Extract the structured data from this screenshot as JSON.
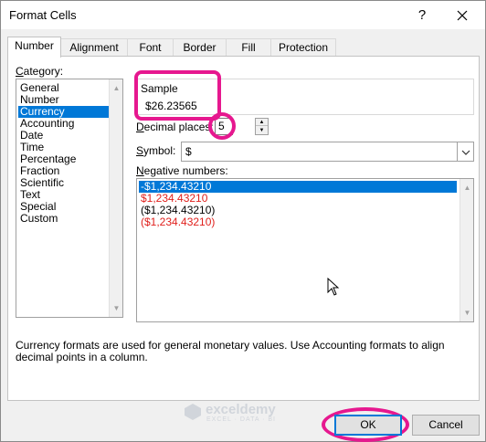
{
  "window": {
    "title": "Format Cells",
    "help_label": "?"
  },
  "tabs": [
    {
      "label": "Number",
      "active": true
    },
    {
      "label": "Alignment",
      "active": false
    },
    {
      "label": "Font",
      "active": false
    },
    {
      "label": "Border",
      "active": false
    },
    {
      "label": "Fill",
      "active": false
    },
    {
      "label": "Protection",
      "active": false
    }
  ],
  "category": {
    "label": "Category:",
    "items": [
      "General",
      "Number",
      "Currency",
      "Accounting",
      "Date",
      "Time",
      "Percentage",
      "Fraction",
      "Scientific",
      "Text",
      "Special",
      "Custom"
    ],
    "selected": "Currency"
  },
  "sample": {
    "label": "Sample",
    "value": "$26.23565"
  },
  "decimal_places": {
    "label": "Decimal places:",
    "value": "5"
  },
  "symbol": {
    "label": "Symbol:",
    "value": "$"
  },
  "negative_numbers": {
    "label": "Negative numbers:",
    "items": [
      {
        "text": "-$1,234.43210",
        "color": "#000000",
        "selected": true
      },
      {
        "text": "$1,234.43210",
        "color": "#e0201c",
        "selected": false
      },
      {
        "text": "($1,234.43210)",
        "color": "#000000",
        "selected": false
      },
      {
        "text": "($1,234.43210)",
        "color": "#e0201c",
        "selected": false
      }
    ]
  },
  "description": "Currency formats are used for general monetary values.  Use Accounting formats to align decimal points in a column.",
  "buttons": {
    "ok": "OK",
    "cancel": "Cancel"
  },
  "watermark": {
    "name": "exceldemy",
    "tagline": "EXCEL · DATA · BI"
  },
  "colors": {
    "highlight": "#e6188f",
    "selection": "#0078d7"
  }
}
